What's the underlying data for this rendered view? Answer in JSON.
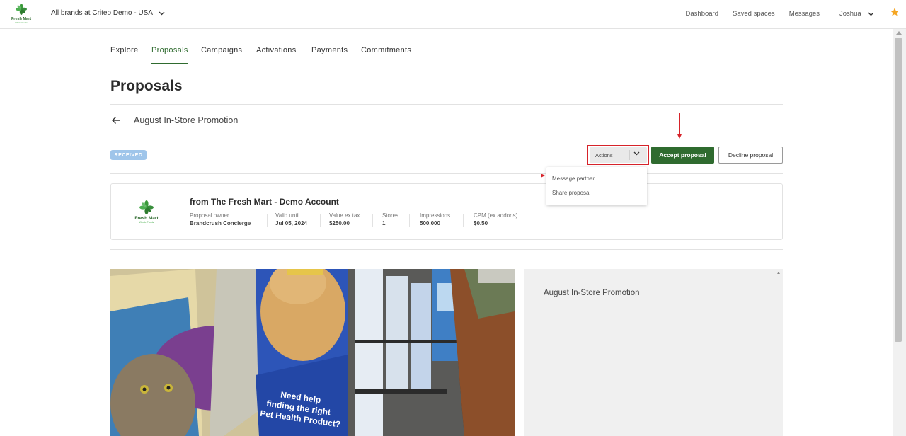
{
  "header": {
    "logo": {
      "name": "Fresh Mart",
      "tagline": "Whole Foods"
    },
    "brand_selector": "All brands at Criteo Demo - USA",
    "nav": [
      "Dashboard",
      "Saved spaces",
      "Messages"
    ],
    "user": "Joshua",
    "star_color": "#f5a623"
  },
  "subnav": {
    "tabs": [
      "Explore",
      "Proposals",
      "Campaigns",
      "Activations",
      "Payments",
      "Commitments"
    ],
    "active_tab": "Proposals"
  },
  "page": {
    "title": "Proposals",
    "proposal_name": "August In-Store Promotion",
    "status_badge": "RECEIVED"
  },
  "toolbar": {
    "actions_label": "Actions",
    "accept_label": "Accept proposal",
    "decline_label": "Decline proposal"
  },
  "actions_menu": {
    "items": [
      "Message partner",
      "Share proposal"
    ]
  },
  "card": {
    "logo": {
      "name": "Fresh Mart",
      "tagline": "Whole Foods"
    },
    "title": "from The Fresh Mart - Demo Account",
    "stats": [
      {
        "label": "Proposal owner",
        "value": "Brandcrush Concierge"
      },
      {
        "label": "Valid until",
        "value": "Jul 05, 2024"
      },
      {
        "label": "Value ex tax",
        "value": "$250.00"
      },
      {
        "label": "Stores",
        "value": "1"
      },
      {
        "label": "Impressions",
        "value": "500,000"
      },
      {
        "label": "CPM (ex addons)",
        "value": "$0.50"
      }
    ]
  },
  "photo": {
    "sign_text": [
      "Need help",
      "finding the right",
      "Pet Health Product?"
    ]
  },
  "side_panel": {
    "title": "August In-Store Promotion"
  },
  "colors": {
    "accent_green": "#2f6b2f",
    "annotation_red": "#d6232a",
    "badge_blue": "#9fc5ea"
  }
}
